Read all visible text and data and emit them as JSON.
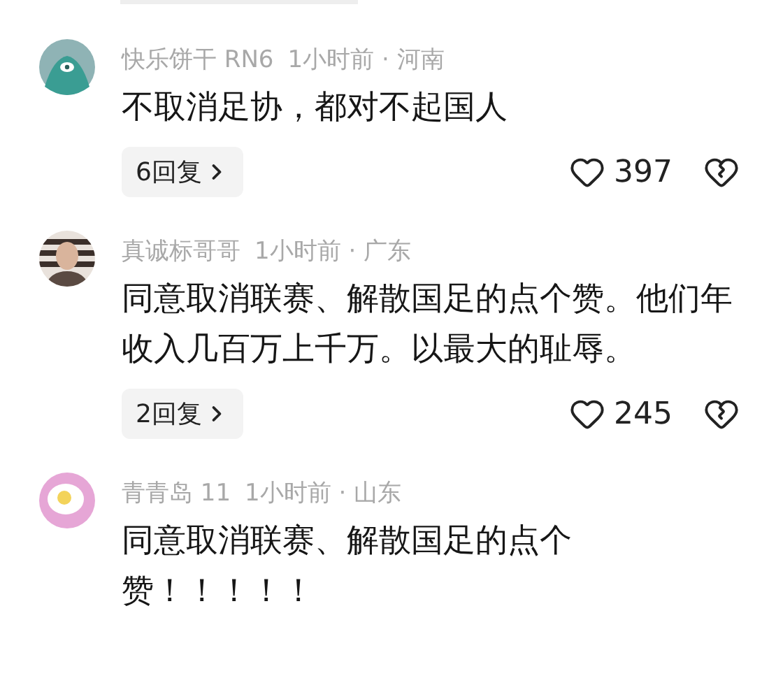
{
  "comments": [
    {
      "avatar": {
        "kind": "monster"
      },
      "author": "快乐饼干 RN6",
      "meta": "1小时前 · 河南",
      "lines": [
        "不取消足协，都对不起国人"
      ],
      "replies": "6回复",
      "likes": "397"
    },
    {
      "avatar": {
        "kind": "person"
      },
      "author": "真诚标哥哥",
      "meta": "1小时前 · 广东",
      "lines": [
        "同意取消联赛、解散国足的点个赞。他们年收入几百万上千万。以最大的耻辱。"
      ],
      "replies": "2回复",
      "likes": "245"
    },
    {
      "avatar": {
        "kind": "egg"
      },
      "author": "青青岛 11",
      "meta": "1小时前 · 山东",
      "lines": [
        "同意取消联赛、解散国足的点个",
        "赞！！！！！"
      ]
    }
  ]
}
